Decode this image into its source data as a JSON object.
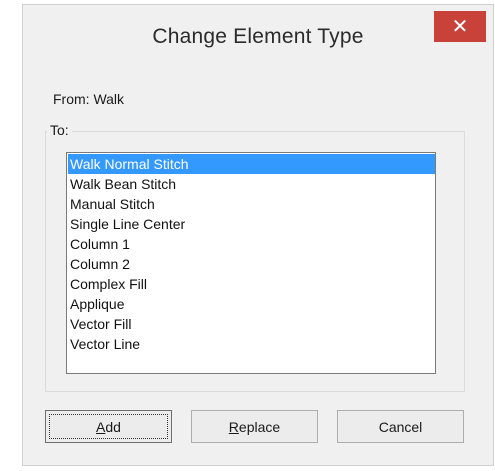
{
  "window": {
    "title": "Change Element Type",
    "close_glyph": "✕"
  },
  "from": {
    "text": "From: Walk"
  },
  "to": {
    "legend": "To:",
    "selected_index": 0,
    "items": [
      "Walk Normal Stitch",
      "Walk Bean Stitch",
      "Manual Stitch",
      "Single Line Center",
      "Column 1",
      "Column 2",
      "Complex Fill",
      "Applique",
      "Vector Fill",
      "Vector Line"
    ]
  },
  "buttons": {
    "add": {
      "mnemonic": "A",
      "rest": "dd"
    },
    "replace": {
      "mnemonic": "R",
      "rest": "eplace"
    },
    "cancel": {
      "label": "Cancel"
    }
  },
  "colors": {
    "selection": "#3399ff",
    "close_button": "#c9423a"
  },
  "icons": {
    "close": "close-icon"
  }
}
